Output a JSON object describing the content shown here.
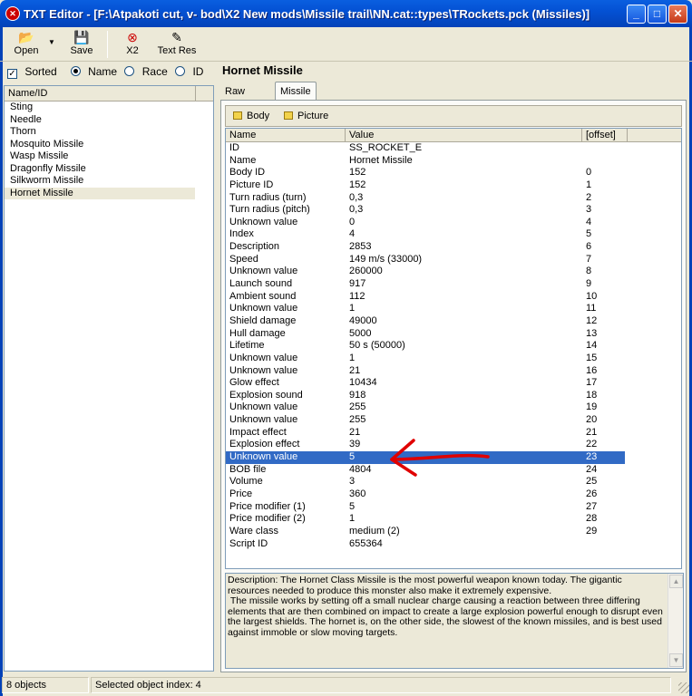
{
  "window": {
    "title": "TXT Editor - [F:\\Atpakoti cut, v- bod\\X2 New mods\\Missile trail\\NN.cat::types\\TRockets.pck (Missiles)]",
    "controls": [
      "minimize",
      "maximize",
      "close"
    ]
  },
  "toolbar": {
    "open_label": "Open",
    "save_label": "Save",
    "x2_label": "X2",
    "textres_label": "Text Res"
  },
  "options": {
    "sorted_label": "Sorted",
    "sorted_checked": true,
    "name_label": "Name",
    "race_label": "Race",
    "id_label": "ID",
    "selected_sort": "Name"
  },
  "list": {
    "header": "Name/ID",
    "items": [
      "Sting",
      "Needle",
      "Thorn",
      "Mosquito Missile",
      "Wasp Missile",
      "Dragonfly Missile",
      "Silkworm Missile",
      "Hornet Missile"
    ],
    "selected": "Hornet Missile"
  },
  "detail": {
    "heading": "Hornet Missile",
    "tabs": [
      "Raw data",
      "Missile info"
    ],
    "active_tab": "Missile info",
    "body_button": "Body",
    "picture_button": "Picture",
    "columns": [
      "Name",
      "Value",
      "[offset]"
    ],
    "rows": [
      [
        "ID",
        "SS_ROCKET_E",
        ""
      ],
      [
        "Name",
        "Hornet Missile",
        ""
      ],
      [
        "Body ID",
        "152",
        "0"
      ],
      [
        "Picture ID",
        "152",
        "1"
      ],
      [
        "Turn radius (turn)",
        "0,3",
        "2"
      ],
      [
        "Turn radius (pitch)",
        "0,3",
        "3"
      ],
      [
        "Unknown value",
        "0",
        "4"
      ],
      [
        "Index",
        "4",
        "5"
      ],
      [
        "Description",
        "2853",
        "6"
      ],
      [
        "Speed",
        "149 m/s (33000)",
        "7"
      ],
      [
        "Unknown value",
        "260000",
        "8"
      ],
      [
        "Launch sound",
        "917",
        "9"
      ],
      [
        "Ambient sound",
        "112",
        "10"
      ],
      [
        "Unknown value",
        "1",
        "11"
      ],
      [
        "Shield damage",
        "49000",
        "12"
      ],
      [
        "Hull damage",
        "5000",
        "13"
      ],
      [
        "Lifetime",
        "50 s (50000)",
        "14"
      ],
      [
        "Unknown value",
        "1",
        "15"
      ],
      [
        "Unknown value",
        "21",
        "16"
      ],
      [
        "Glow effect",
        "10434",
        "17"
      ],
      [
        "Explosion sound",
        "918",
        "18"
      ],
      [
        "Unknown value",
        "255",
        "19"
      ],
      [
        "Unknown value",
        "255",
        "20"
      ],
      [
        "Impact effect",
        "21",
        "21"
      ],
      [
        "Explosion effect",
        "39",
        "22"
      ],
      [
        "Unknown value",
        "5",
        "23"
      ],
      [
        "BOB file",
        "4804",
        "24"
      ],
      [
        "Volume",
        "3",
        "25"
      ],
      [
        "Price",
        "360",
        "26"
      ],
      [
        "Price modifier (1)",
        "5",
        "27"
      ],
      [
        "Price modifier (2)",
        "1",
        "28"
      ],
      [
        "Ware class",
        "medium (2)",
        "29"
      ],
      [
        "Script ID",
        "655364",
        ""
      ]
    ],
    "selected_row": 25,
    "description": "Description: The Hornet Class Missile is the most powerful weapon known today. The gigantic resources needed to produce this monster also make it extremely expensive.\n The missile works by setting off a small nuclear charge causing a reaction between three differing elements that are then combined on impact to create a large explosion powerful enough to disrupt even the largest shields. The hornet is, on the other side, the slowest of the known missiles, and is best used against immoble or slow moving targets."
  },
  "status": {
    "count": "8 objects",
    "selection": "Selected object index: 4"
  },
  "annotation": {
    "arrow_color": "#e00000",
    "arrow_direction": "left",
    "points_to_row": 25
  },
  "colors": {
    "title_bar": "#0451d4",
    "selection": "#316ac5",
    "window_bg": "#ece9d8"
  }
}
